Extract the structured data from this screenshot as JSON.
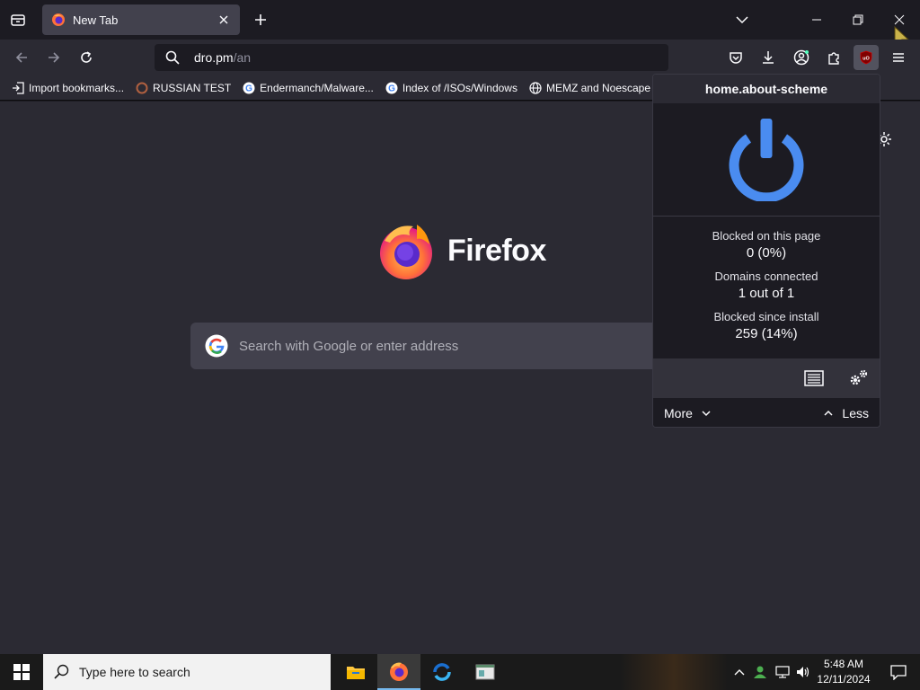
{
  "tab": {
    "title": "New Tab"
  },
  "urlbar": {
    "host": "dro.pm",
    "path": "/an"
  },
  "bookmarks": [
    {
      "label": "Import bookmarks...",
      "icon": "import-icon"
    },
    {
      "label": "RUSSIAN TEST",
      "icon": "site-icon"
    },
    {
      "label": "Endermanch/Malware...",
      "icon": "google-icon"
    },
    {
      "label": "Index of /ISOs/Windows",
      "icon": "google-icon"
    },
    {
      "label": "MEMZ and Noescape ...",
      "icon": "globe-icon"
    }
  ],
  "newtab": {
    "brand": "Firefox",
    "search_placeholder": "Search with Google or enter address"
  },
  "popup": {
    "hostname": "home.about-scheme",
    "blocked_page_label": "Blocked on this page",
    "blocked_page_value": "0 (0%)",
    "domains_label": "Domains connected",
    "domains_value": "1 out of 1",
    "blocked_install_label": "Blocked since install",
    "blocked_install_value": "259 (14%)",
    "more_label": "More",
    "less_label": "Less",
    "power_color": "#4a8cf0"
  },
  "taskbar": {
    "search_placeholder": "Type here to search",
    "time": "5:48 AM",
    "date": "12/11/2024"
  }
}
